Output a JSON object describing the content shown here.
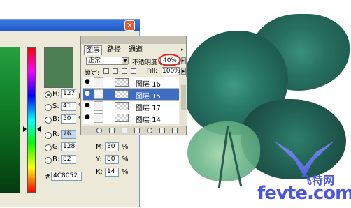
{
  "layers_panel": {
    "tabs": [
      "图层",
      "路径",
      "通道"
    ],
    "active_tab": "图层",
    "blend_mode": "正常",
    "opacity_label": "不透明度:",
    "opacity_value": "40%",
    "lock_label": "锁定:",
    "fill_label": "Fill:",
    "fill_value": "100%",
    "layers": [
      {
        "name": "图层 16",
        "active": false
      },
      {
        "name": "图层 15",
        "active": true
      },
      {
        "name": "图层 17",
        "active": false
      },
      {
        "name": "图层 14",
        "active": false
      }
    ]
  },
  "color_picker": {
    "current_color": "#4c8052",
    "fields": {
      "H": {
        "label": "H:",
        "value": "127",
        "unit": "度"
      },
      "S": {
        "label": "S:",
        "value": "41",
        "unit": "%"
      },
      "B": {
        "label": "B:",
        "value": "50",
        "unit": "%"
      },
      "R": {
        "label": "R:",
        "value": "76"
      },
      "G": {
        "label": "G:",
        "value": "128"
      },
      "Bl": {
        "label": "B:",
        "value": "82"
      },
      "M": {
        "label": "M:",
        "value": "30",
        "unit": "%"
      },
      "Y": {
        "label": "Y:",
        "value": "80",
        "unit": "%"
      },
      "K": {
        "label": "K:",
        "value": "14",
        "unit": "%"
      }
    },
    "hex_label": "#",
    "hex_value": "4C8052"
  },
  "watermark": {
    "text": "飞特网",
    "url": "fevte.com"
  }
}
